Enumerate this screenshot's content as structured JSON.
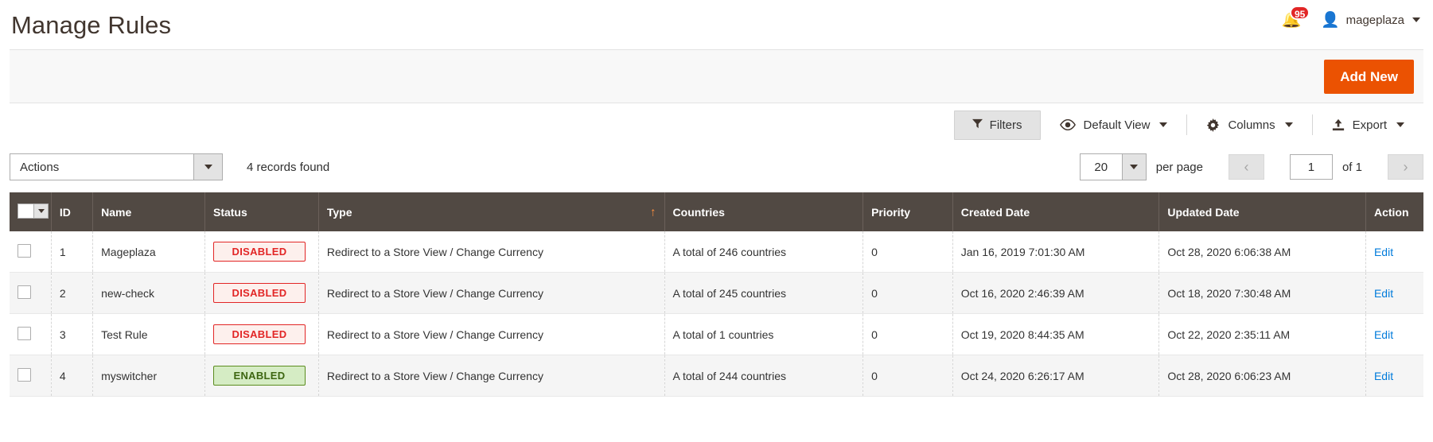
{
  "header": {
    "title": "Manage Rules",
    "notification_count": "95",
    "user_name": "mageplaza",
    "bell_icon": "bell-icon",
    "user_icon": "user-avatar-icon"
  },
  "action_bar": {
    "add_new_label": "Add New"
  },
  "toolbar": {
    "filters_label": "Filters",
    "default_view_label": "Default View",
    "columns_label": "Columns",
    "export_label": "Export"
  },
  "controls": {
    "actions_label": "Actions",
    "records_found": "4 records found",
    "per_page_value": "20",
    "per_page_label": "per page",
    "current_page": "1",
    "of_pages": "of 1"
  },
  "grid": {
    "columns": [
      {
        "key": "checkbox",
        "label": ""
      },
      {
        "key": "id",
        "label": "ID"
      },
      {
        "key": "name",
        "label": "Name"
      },
      {
        "key": "status",
        "label": "Status"
      },
      {
        "key": "type",
        "label": "Type",
        "sorted": "asc"
      },
      {
        "key": "countries",
        "label": "Countries"
      },
      {
        "key": "priority",
        "label": "Priority"
      },
      {
        "key": "created",
        "label": "Created Date"
      },
      {
        "key": "updated",
        "label": "Updated Date"
      },
      {
        "key": "action",
        "label": "Action"
      }
    ],
    "sort_arrow_glyph": "↑",
    "edit_label": "Edit",
    "rows": [
      {
        "id": "1",
        "name": "Mageplaza",
        "status": "DISABLED",
        "status_kind": "disabled",
        "type": "Redirect to a Store View / Change Currency",
        "countries": "A total of 246 countries",
        "priority": "0",
        "created": "Jan 16, 2019 7:01:30 AM",
        "updated": "Oct 28, 2020 6:06:38 AM",
        "action": "Edit"
      },
      {
        "id": "2",
        "name": "new-check",
        "status": "DISABLED",
        "status_kind": "disabled",
        "type": "Redirect to a Store View / Change Currency",
        "countries": "A total of 245 countries",
        "priority": "0",
        "created": "Oct 16, 2020 2:46:39 AM",
        "updated": "Oct 18, 2020 7:30:48 AM",
        "action": "Edit"
      },
      {
        "id": "3",
        "name": "Test Rule",
        "status": "DISABLED",
        "status_kind": "disabled",
        "type": "Redirect to a Store View / Change Currency",
        "countries": "A total of 1 countries",
        "priority": "0",
        "created": "Oct 19, 2020 8:44:35 AM",
        "updated": "Oct 22, 2020 2:35:11 AM",
        "action": "Edit"
      },
      {
        "id": "4",
        "name": "myswitcher",
        "status": "ENABLED",
        "status_kind": "enabled",
        "type": "Redirect to a Store View / Change Currency",
        "countries": "A total of 244 countries",
        "priority": "0",
        "created": "Oct 24, 2020 6:26:17 AM",
        "updated": "Oct 28, 2020 6:06:23 AM",
        "action": "Edit"
      }
    ]
  },
  "colors": {
    "accent_orange": "#eb5202",
    "header_brown": "#514943",
    "badge_red": "#e22626",
    "badge_green": "#5b8c1f",
    "link_blue": "#007bdb",
    "sort_arrow": "#ff8f3e"
  }
}
